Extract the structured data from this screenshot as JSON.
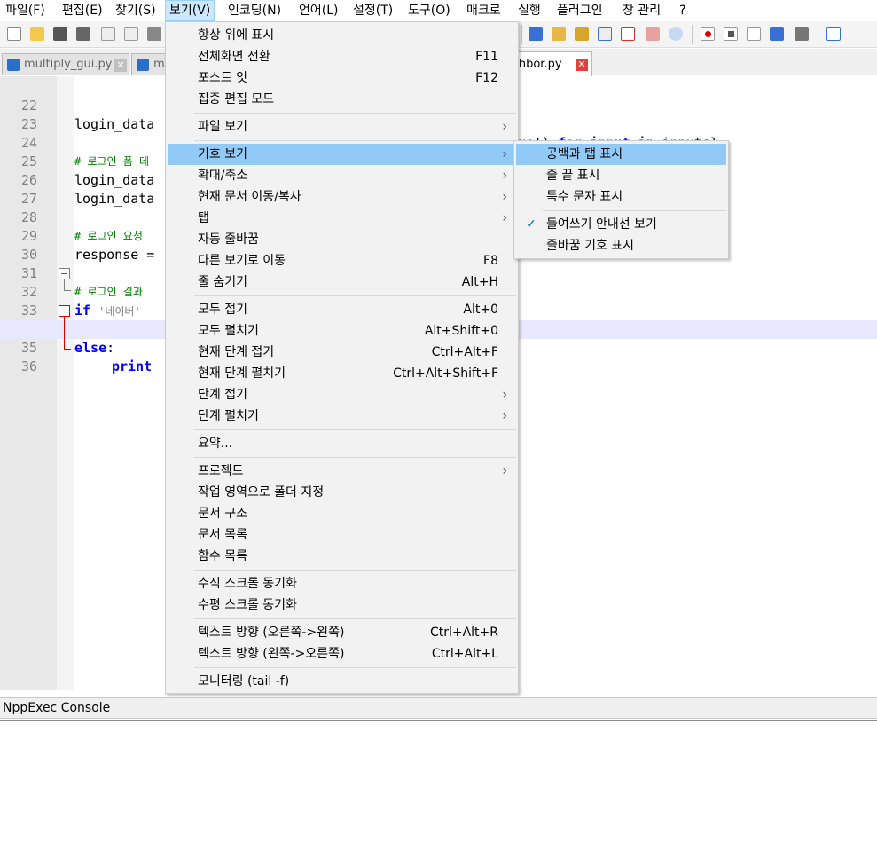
{
  "menubar": {
    "items": [
      "파일(F)",
      "편집(E)",
      "찾기(S)",
      "보기(V)",
      "인코딩(N)",
      "언어(L)",
      "설정(T)",
      "도구(O)",
      "매크로",
      "실행",
      "플러그인",
      "창 관리",
      "?"
    ]
  },
  "tabs": [
    {
      "label": "multiply_gui.py",
      "close": "✕"
    },
    {
      "label": "mo",
      "close": ""
    },
    {
      "label": "ighbor.py",
      "close": "✕"
    }
  ],
  "editor": {
    "lines": [
      {
        "num": "22"
      },
      {
        "num": "23"
      },
      {
        "num": "24"
      },
      {
        "num": "25"
      },
      {
        "num": "26"
      },
      {
        "num": "27"
      },
      {
        "num": "28"
      },
      {
        "num": "29"
      },
      {
        "num": "30"
      },
      {
        "num": "31"
      },
      {
        "num": "32"
      },
      {
        "num": "33"
      },
      {
        "num": "34"
      },
      {
        "num": "35"
      },
      {
        "num": "36"
      }
    ],
    "code": {
      "l22a": "login_data",
      "l22b": "alue')",
      "l22c": "for",
      "l22d": "input",
      "l22e": "in",
      "l22f": "inputs}",
      "l24": "# 로그인 폼 데",
      "l25": "login_data",
      "l26": "login_data",
      "l28": "# 로그인 요청",
      "l29": "response =",
      "l31": "# 로그인 결과",
      "l32kw": "if",
      "l32st": "'네이버'",
      "l33": "print",
      "l34kw": "else",
      "l34p": ":",
      "l35": "print"
    }
  },
  "view_menu": {
    "items": [
      {
        "label": "항상 위에 표시",
        "shortcut": ""
      },
      {
        "label": "전체화면 전환",
        "shortcut": "F11"
      },
      {
        "label": "포스트 잇",
        "shortcut": "F12"
      },
      {
        "label": "집중 편집 모드",
        "shortcut": ""
      },
      {
        "label": "파일 보기",
        "arrow": "›"
      },
      {
        "label": "기호 보기",
        "arrow": "›"
      },
      {
        "label": "확대/축소",
        "arrow": "›"
      },
      {
        "label": "현재 문서 이동/복사",
        "arrow": "›"
      },
      {
        "label": "탭",
        "arrow": "›"
      },
      {
        "label": "자동 줄바꿈",
        "shortcut": ""
      },
      {
        "label": "다른 보기로 이동",
        "shortcut": "F8"
      },
      {
        "label": "줄 숨기기",
        "shortcut": "Alt+H"
      },
      {
        "label": "모두 접기",
        "shortcut": "Alt+0"
      },
      {
        "label": "모두 펼치기",
        "shortcut": "Alt+Shift+0"
      },
      {
        "label": "현재 단계 접기",
        "shortcut": "Ctrl+Alt+F"
      },
      {
        "label": "현재 단계 펼치기",
        "shortcut": "Ctrl+Alt+Shift+F"
      },
      {
        "label": "단계 접기",
        "arrow": "›"
      },
      {
        "label": "단계 펼치기",
        "arrow": "›"
      },
      {
        "label": "요약...",
        "shortcut": ""
      },
      {
        "label": "프로젝트",
        "arrow": "›"
      },
      {
        "label": "작업 영역으로 폴더 지정",
        "shortcut": ""
      },
      {
        "label": "문서 구조",
        "shortcut": ""
      },
      {
        "label": "문서 목록",
        "shortcut": ""
      },
      {
        "label": "함수 목록",
        "shortcut": ""
      },
      {
        "label": "수직 스크롤 동기화",
        "shortcut": ""
      },
      {
        "label": "수평 스크롤 동기화",
        "shortcut": ""
      },
      {
        "label": "텍스트 방향 (오른쪽->왼쪽)",
        "shortcut": "Ctrl+Alt+R"
      },
      {
        "label": "텍스트 방향 (왼쪽->오른쪽)",
        "shortcut": "Ctrl+Alt+L"
      },
      {
        "label": "모니터링 (tail -f)",
        "shortcut": ""
      }
    ]
  },
  "symbol_submenu": {
    "items": [
      {
        "label": "공백과 탭 표시",
        "checked": ""
      },
      {
        "label": "줄 끝 표시",
        "checked": ""
      },
      {
        "label": "특수 문자 표시",
        "checked": ""
      },
      {
        "label": "들여쓰기 안내선 보기",
        "checked": "✓"
      },
      {
        "label": "줄바꿈 기호 표시",
        "checked": ""
      }
    ]
  },
  "console": {
    "title": "NppExec Console"
  }
}
